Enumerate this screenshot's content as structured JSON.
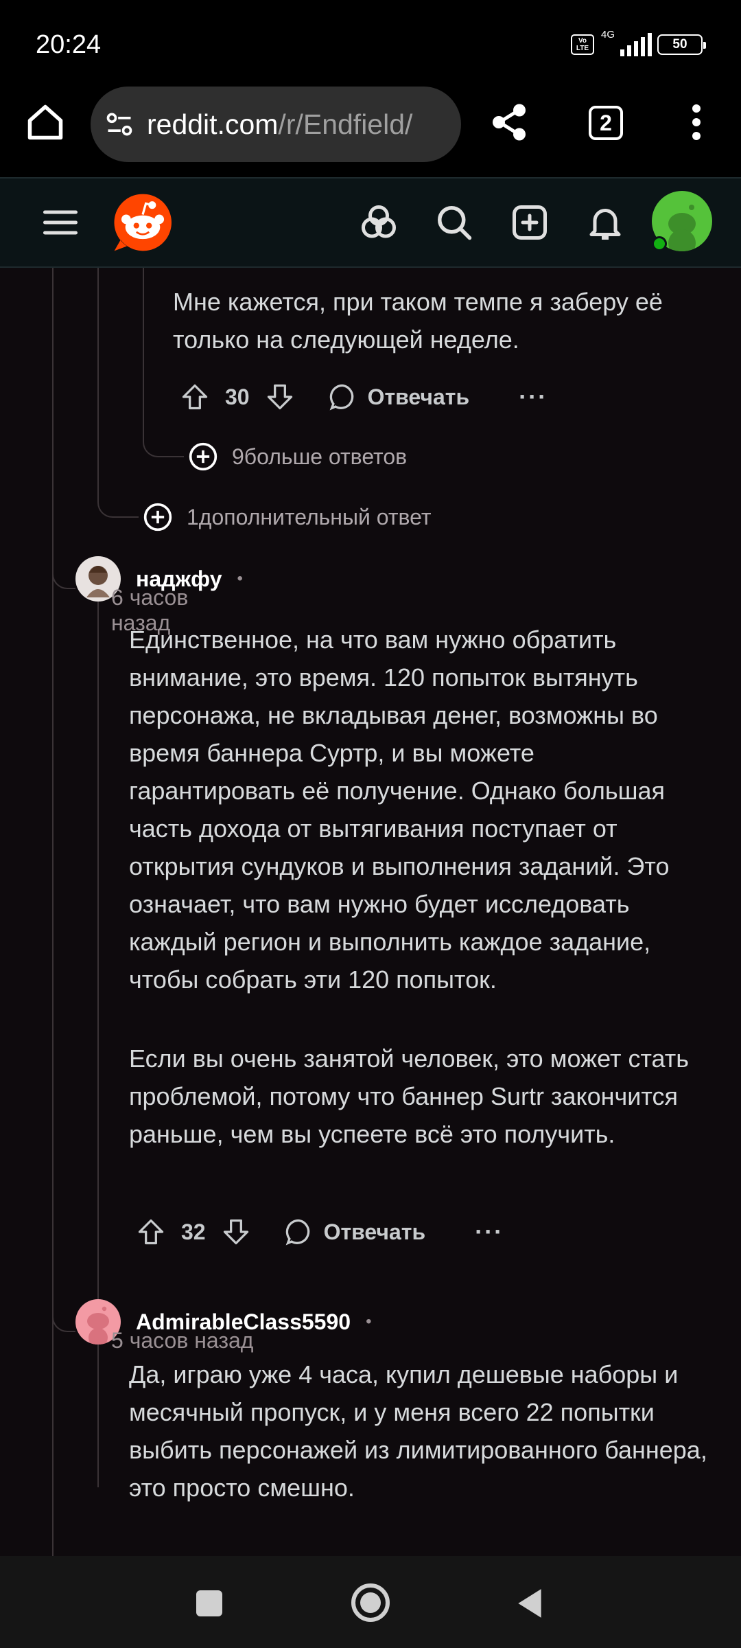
{
  "status_bar": {
    "time": "20:24",
    "volte": "Vo LTE",
    "network": "4G",
    "battery": "50"
  },
  "browser": {
    "url_domain": "reddit.com",
    "url_path": "/r/Endfield/",
    "tab_count": "2",
    "icons": [
      "home-icon",
      "site-settings-icon",
      "share-icon",
      "tabs-icon",
      "menu-icon"
    ]
  },
  "reddit_header": {
    "icons": [
      "hamburger-icon",
      "reddit-logo",
      "communities-icon",
      "search-icon",
      "create-post-icon",
      "notifications-icon",
      "user-avatar"
    ]
  },
  "comments": {
    "prev_reply": {
      "text": "Мне кажется, при таком темпе я заберу её только на следующей неделе.",
      "score": "30",
      "reply_label": "Отвечать",
      "more_label": "···"
    },
    "more_replies_9": "9больше ответов",
    "more_replies_1": "1дополнительный ответ",
    "comment1": {
      "author": "наджфу",
      "dot": "•",
      "time": "6 часов назад",
      "para1": "Единственное, на что вам нужно обратить внимание, это время. 120 попыток вытянуть персонажа, не вкладывая денег, возможны во время баннера Суртр, и вы можете гарантировать её получение. Однако большая часть дохода от вытягивания поступает от открытия сундуков и выполнения заданий. Это означает, что вам нужно будет исследовать каждый регион и выполнить каждое задание, чтобы собрать эти 120 попыток.",
      "para2": "Если вы очень занятой человек, это может стать проблемой, потому что баннер Surtr закончится раньше, чем вы успеете всё это получить.",
      "score": "32",
      "reply_label": "Отвечать",
      "more_label": "···"
    },
    "comment2": {
      "author": "AdmirableClass5590",
      "dot": "•",
      "time": "5 часов назад",
      "text": "Да, играю уже 4 часа, купил дешевые наборы и месячный пропуск, и у меня всего 22 попытки выбить персонажей из лимитированного баннера, это просто смешно."
    }
  },
  "colors": {
    "reddit_orange": "#ff4500",
    "background": "#0e0a0d",
    "avatar_green": "#55c23a"
  }
}
